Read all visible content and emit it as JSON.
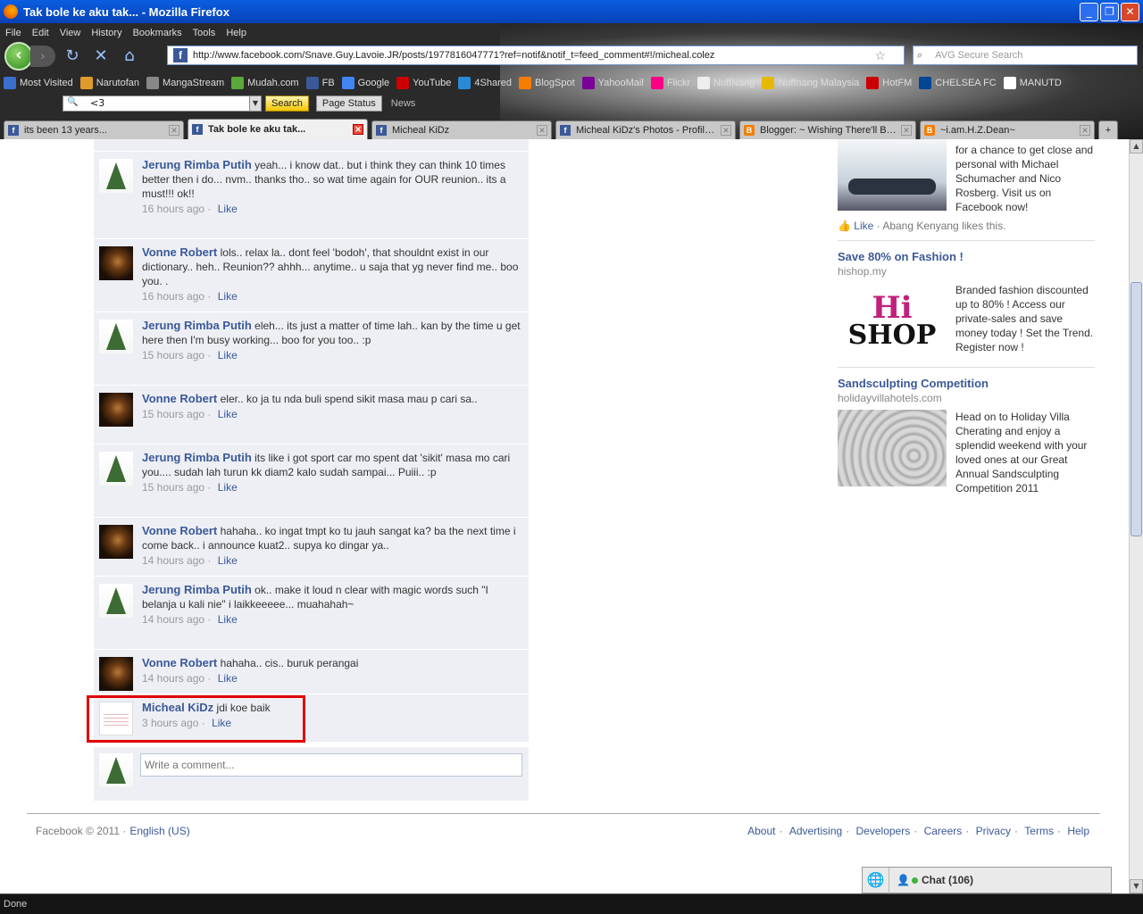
{
  "window": {
    "title": "Tak bole ke aku tak... - Mozilla Firefox"
  },
  "menu": [
    "File",
    "Edit",
    "View",
    "History",
    "Bookmarks",
    "Tools",
    "Help"
  ],
  "address": {
    "url": "http://www.facebook.com/Snave.Guy.Lavoie.JR/posts/1977816047771?ref=notif&notif_t=feed_comment#!/micheal.colez"
  },
  "search": {
    "placeholder": "AVG Secure Search"
  },
  "bookmarks": [
    "Most Visited",
    "Narutofan",
    "MangaStream",
    "Mudah.com",
    "FB",
    "Google",
    "YouTube",
    "4Shared",
    "BlogSpot",
    "YahooMail",
    "Flickr",
    "NuffNang",
    "Nuffnang Malaysia",
    "HotFM",
    "CHELSEA FC",
    "MANUTD"
  ],
  "toolbar": {
    "query": "<3",
    "search_label": "Search",
    "status_label": "Page Status",
    "news_label": "News"
  },
  "tabs": [
    {
      "label": "its been 13 years..."
    },
    {
      "label": "Tak bole ke aku tak..."
    },
    {
      "label": "Micheal KiDz"
    },
    {
      "label": "Micheal KiDz's Photos - Profile..."
    },
    {
      "label": "Blogger: ~ Wishing There'll Be..."
    },
    {
      "label": "~i.am.H.Z.Dean~"
    }
  ],
  "comments": [
    {
      "name": "Jerung Rimba Putih",
      "text": "yeah... i know dat.. but i think they can think 10 times better then i do... nvm.. thanks tho.. so wat time again for OUR reunion.. its a must!!! ok!!",
      "time": "16 hours ago",
      "like": "Like"
    },
    {
      "name": "Vonne Robert",
      "text": "lols.. relax la.. dont feel 'bodoh', that shouldnt exist in our dictionary.. heh.. Reunion?? ahhh... anytime.. u saja that yg never find me.. boo you. .",
      "time": "16 hours ago",
      "like": "Like"
    },
    {
      "name": "Jerung Rimba Putih",
      "text": "eleh... its just a matter of time lah.. kan by the time u get here then I'm busy working... boo for you too.. :p",
      "time": "15 hours ago",
      "like": "Like"
    },
    {
      "name": "Vonne Robert",
      "text": "eler.. ko ja tu nda buli spend sikit masa mau p cari sa..",
      "time": "15 hours ago",
      "like": "Like"
    },
    {
      "name": "Jerung Rimba Putih",
      "text": "its like i got sport car mo spent dat 'sikit' masa mo cari you.... sudah lah turun kk diam2 kalo sudah sampai... Puiii.. :p",
      "time": "15 hours ago",
      "like": "Like"
    },
    {
      "name": "Vonne Robert",
      "text": "hahaha.. ko ingat tmpt ko tu jauh sangat ka? ba the next time i come back.. i announce kuat2.. supya ko dingar ya..",
      "time": "14 hours ago",
      "like": "Like"
    },
    {
      "name": "Jerung Rimba Putih",
      "text": "ok.. make it loud n clear with magic words such \"I belanja u kali nie\" i laikkeeeee... muahahah~",
      "time": "14 hours ago",
      "like": "Like"
    },
    {
      "name": "Vonne Robert",
      "text": "hahaha.. cis.. buruk perangai",
      "time": "14 hours ago",
      "like": "Like"
    },
    {
      "name": "Micheal KiDz",
      "text": "jdi koe baik",
      "time": "3 hours ago",
      "like": "Like"
    }
  ],
  "add_comment": {
    "placeholder": "Write a comment..."
  },
  "ads": {
    "top": {
      "text": "for a chance to get close and personal with Michael Schumacher and Nico Rosberg. Visit us on Facebook now!",
      "like": "Like",
      "likes_text": "Abang Kenyang likes this."
    },
    "items": [
      {
        "title": "Save 80% on Fashion !",
        "domain": "hishop.my",
        "text": "Branded fashion discounted up to 80% ! Access our private-sales and save money today ! Set the Trend. Register now !",
        "logo_hi": "Hi",
        "logo_shop": "SHOP"
      },
      {
        "title": "Sandsculpting Competition",
        "domain": "holidayvillahotels.com",
        "text": "Head on to Holiday Villa Cherating and enjoy a splendid weekend with your loved ones at our Great Annual Sandsculpting Competition 2011"
      }
    ]
  },
  "footer": {
    "copyright": "Facebook © 2011 ·",
    "language": "English (US)",
    "links": [
      "About",
      "Advertising",
      "Developers",
      "Careers",
      "Privacy",
      "Terms",
      "Help"
    ]
  },
  "chat": {
    "label": "Chat (106)"
  },
  "status": {
    "text": "Done"
  }
}
